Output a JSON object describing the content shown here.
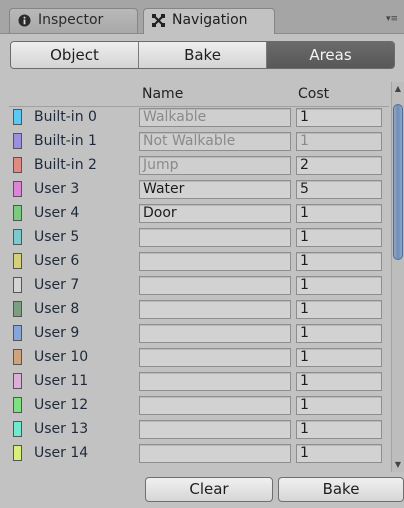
{
  "tabs": [
    {
      "label": "Inspector",
      "icon": "info-icon",
      "active": false
    },
    {
      "label": "Navigation",
      "icon": "navigation-icon",
      "active": true
    }
  ],
  "toolbar": {
    "segments": [
      {
        "label": "Object",
        "selected": false
      },
      {
        "label": "Bake",
        "selected": false
      },
      {
        "label": "Areas",
        "selected": true
      }
    ]
  },
  "table": {
    "columns": {
      "name": "Name",
      "cost": "Cost"
    },
    "rows": [
      {
        "label": "Built-in 0",
        "color": "#5cc9f2",
        "name": "Walkable",
        "cost": "1",
        "builtin": true
      },
      {
        "label": "Built-in 1",
        "color": "#9b8fe0",
        "name": "Not Walkable",
        "cost": "1",
        "builtin": true
      },
      {
        "label": "Built-in 2",
        "color": "#e08a84",
        "name": "Jump",
        "cost": "2",
        "builtin": true
      },
      {
        "label": "User 3",
        "color": "#dd83d8",
        "name": "Water",
        "cost": "5",
        "builtin": false
      },
      {
        "label": "User 4",
        "color": "#79cc7d",
        "name": "Door",
        "cost": "1",
        "builtin": false
      },
      {
        "label": "User 5",
        "color": "#7ccbcc",
        "name": "",
        "cost": "1",
        "builtin": false
      },
      {
        "label": "User 6",
        "color": "#d7d07a",
        "name": "",
        "cost": "1",
        "builtin": false
      },
      {
        "label": "User 7",
        "color": "#d4d4d4",
        "name": "",
        "cost": "1",
        "builtin": false
      },
      {
        "label": "User 8",
        "color": "#7d9f7f",
        "name": "",
        "cost": "1",
        "builtin": false
      },
      {
        "label": "User 9",
        "color": "#85a6d8",
        "name": "",
        "cost": "1",
        "builtin": false
      },
      {
        "label": "User 10",
        "color": "#cfa37c",
        "name": "",
        "cost": "1",
        "builtin": false
      },
      {
        "label": "User 11",
        "color": "#dcafd8",
        "name": "",
        "cost": "1",
        "builtin": false
      },
      {
        "label": "User 12",
        "color": "#7fe080",
        "name": "",
        "cost": "1",
        "builtin": false
      },
      {
        "label": "User 13",
        "color": "#74e8ce",
        "name": "",
        "cost": "1",
        "builtin": false
      },
      {
        "label": "User 14",
        "color": "#d6f07a",
        "name": "",
        "cost": "1",
        "builtin": false
      }
    ]
  },
  "buttons": {
    "clear": "Clear",
    "bake": "Bake"
  }
}
